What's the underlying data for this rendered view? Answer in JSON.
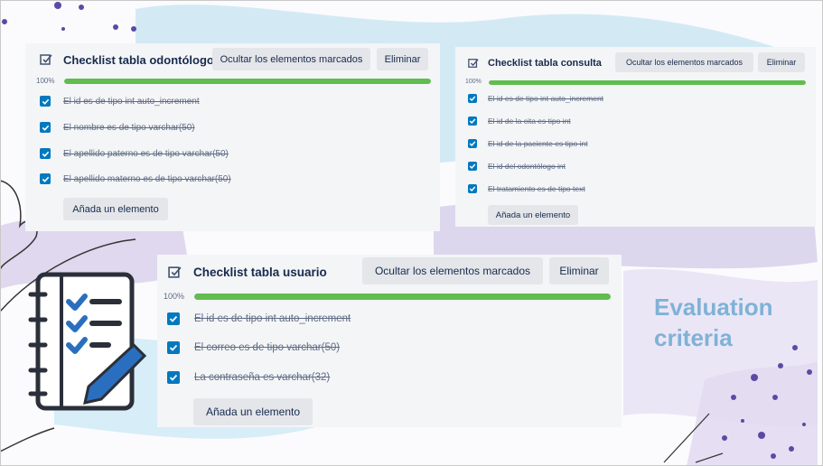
{
  "checklists": [
    {
      "title": "Checklist tabla odontólogo",
      "hide_label": "Ocultar los elementos marcados",
      "delete_label": "Eliminar",
      "progress_label": "100%",
      "progress": 1.0,
      "items": [
        "El id es de tipo int auto_increment",
        "El nombre es de tipo varchar(50)",
        "El apellido paterno es de tipo varchar(50)",
        "El apellido materno es de tipo varchar(50)"
      ],
      "add_label": "Añada un elemento"
    },
    {
      "title": "Checklist tabla consulta",
      "hide_label": "Ocultar los elementos marcados",
      "delete_label": "Eliminar",
      "progress_label": "100%",
      "progress": 1.0,
      "items": [
        "El id es de tipo int auto_increment",
        "El id de la cita es tipo int",
        "El id de la paciente es tipo int",
        "El id del odontólogo int",
        "El tratamiento es de tipo text"
      ],
      "add_label": "Añada un elemento"
    },
    {
      "title": "Checklist tabla usuario",
      "hide_label": "Ocultar los elementos marcados",
      "delete_label": "Eliminar",
      "progress_label": "100%",
      "progress": 1.0,
      "items": [
        "El id es de tipo int auto_increment",
        "El correo es de tipo varchar(50)",
        "La contraseña es varchar(32)"
      ],
      "add_label": "Añada un elemento"
    }
  ],
  "evaluation": {
    "line1": "Evaluation",
    "line2": "criteria"
  },
  "colors": {
    "accent": "#0079bf",
    "progress": "#61bd4f",
    "eval_text": "#7fb2d6"
  }
}
